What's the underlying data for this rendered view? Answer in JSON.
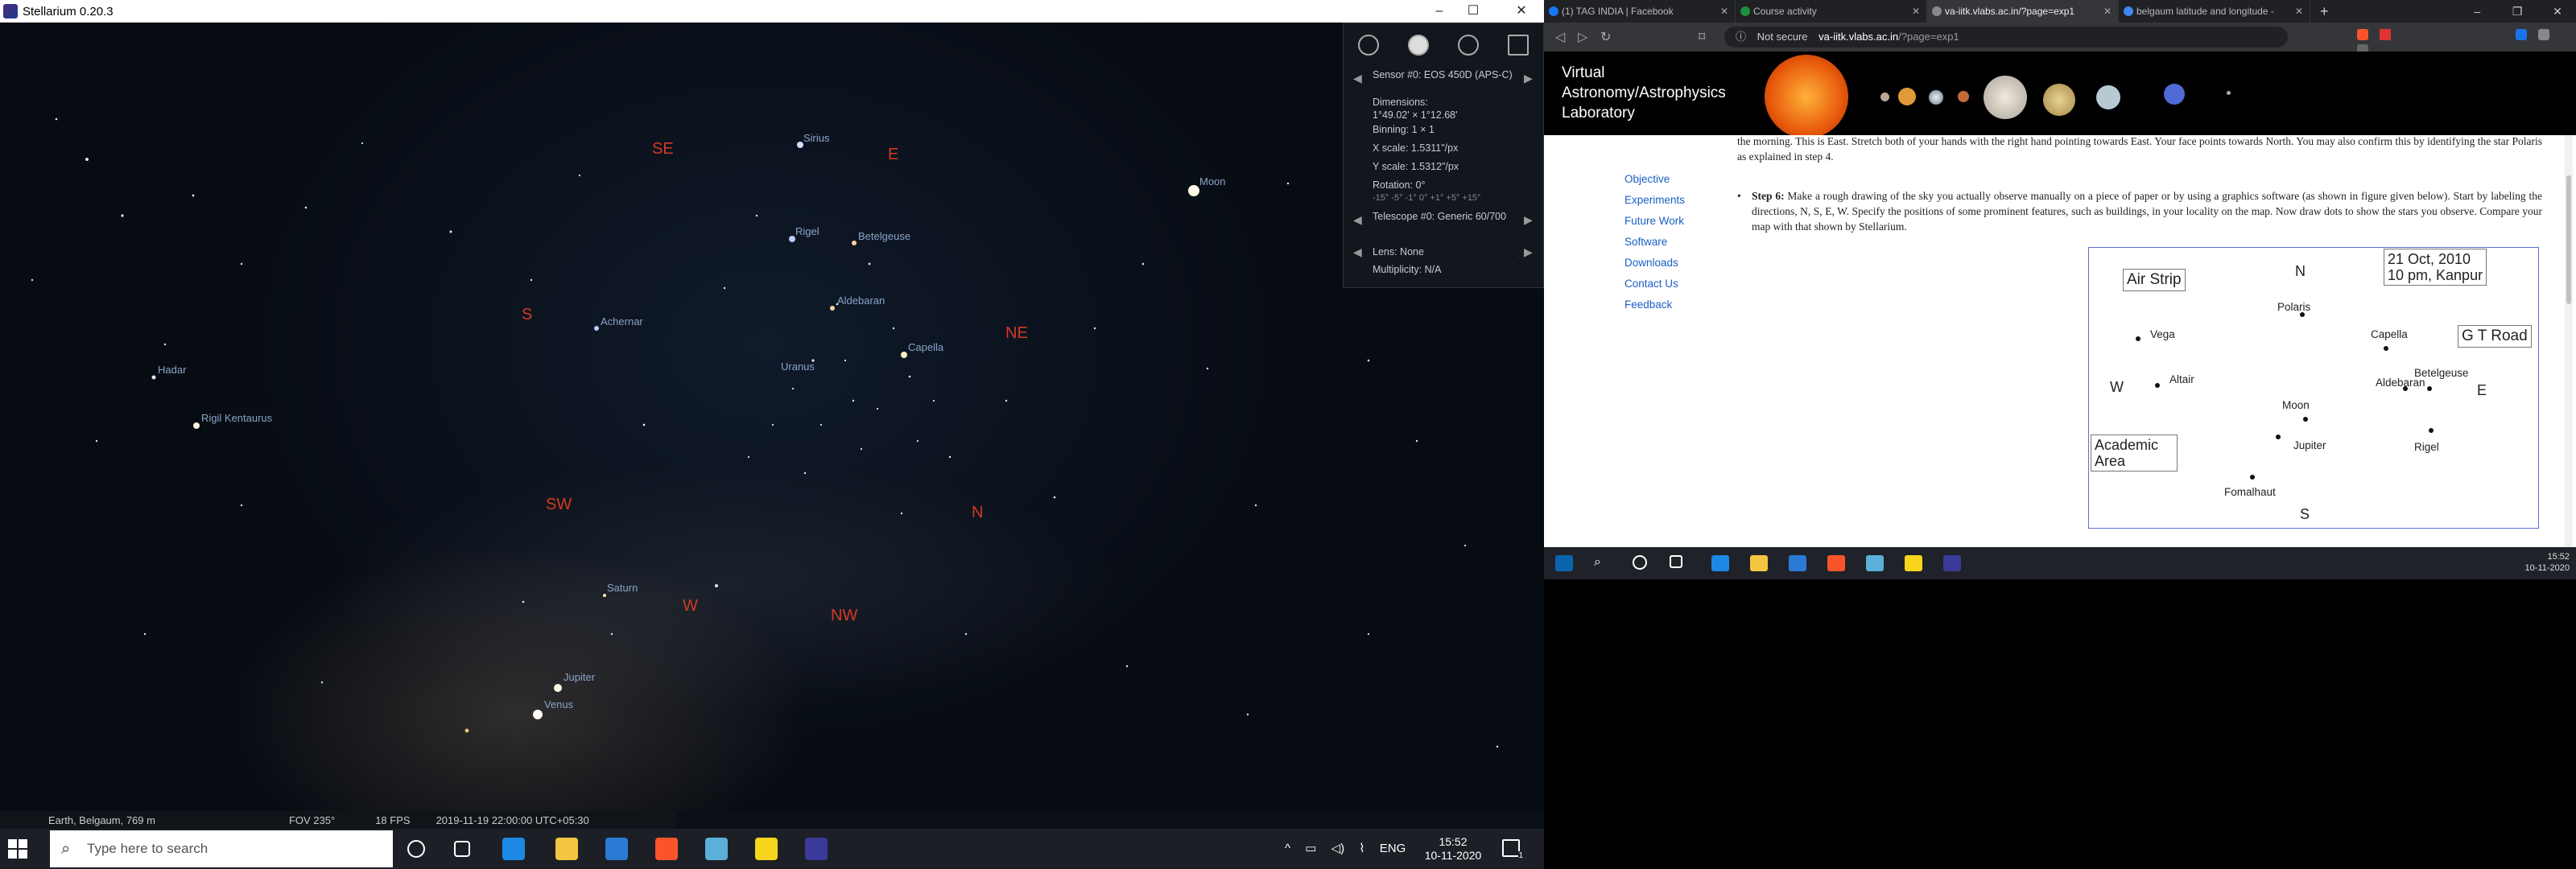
{
  "stellarium": {
    "title": "Stellarium 0.20.3",
    "window_controls": [
      "–",
      "☐",
      "✕"
    ],
    "stars": [
      {
        "name": "Sirius"
      },
      {
        "name": "Moon"
      },
      {
        "name": "Rigel"
      },
      {
        "name": "Betelgeuse"
      },
      {
        "name": "Aldebaran"
      },
      {
        "name": "Capella"
      },
      {
        "name": "Achernar"
      },
      {
        "name": "Uranus"
      },
      {
        "name": "Hadar"
      },
      {
        "name": "Rigil Kentaurus"
      },
      {
        "name": "Saturn"
      },
      {
        "name": "Jupiter"
      },
      {
        "name": "Venus"
      }
    ],
    "directions": [
      "SE",
      "E",
      "S",
      "NE",
      "SW",
      "N",
      "W",
      "NW"
    ],
    "sensor_panel": {
      "sensor": "Sensor #0: EOS 450D (APS-C)",
      "dimensions_label": "Dimensions:",
      "dimensions_value": "1°49.02' × 1°12.68'",
      "binning": "Binning: 1 × 1",
      "x_scale": "X scale: 1.5311\"/px",
      "y_scale": "Y scale: 1.5312\"/px",
      "rotation": "Rotation: 0°",
      "rotation_steps": "-15° -5° -1° 0° +1° +5° +15°",
      "telescope": "Telescope #0: Generic 60/700",
      "lens": "Lens: None",
      "multiplicity": "Multiplicity: N/A"
    },
    "status": {
      "location": "Earth, Belgaum, 769 m",
      "fov": "FOV 235°",
      "fps": "18 FPS",
      "datetime": "2019-11-19 22:00:00 UTC+05:30"
    }
  },
  "browser": {
    "tabs": [
      {
        "label": "(1) TAG INDIA | Facebook",
        "color": "#1877f2"
      },
      {
        "label": "Course activity",
        "color": "#1e8e3e"
      },
      {
        "label": "va-iitk.vlabs.ac.in/?page=exp1",
        "color": "#888888"
      },
      {
        "label": "belgaum latitude and longitude -",
        "color": "#4285f4"
      }
    ],
    "new_tab": "+",
    "window_controls": [
      "–",
      "❐",
      "✕"
    ],
    "url": {
      "security": "Not secure",
      "host": "va-iitk.vlabs.ac.in",
      "path": "/?page=exp1"
    },
    "site": {
      "title_lines": [
        "Virtual",
        "Astronomy/Astrophysics",
        "Laboratory"
      ],
      "nav": [
        "Objective",
        "Experiments",
        "Future Work",
        "Software",
        "Downloads",
        "Contact Us",
        "Feedback"
      ],
      "para1": "the morning. This is East. Stretch both of your hands with the right hand pointing towards East. Your face points towards North. You may also confirm this by identifying the star Polaris as explained in step 4.",
      "step_label": "Step 6:",
      "step_text": "Make a rough drawing of the sky you actually observe manually on a piece of paper or by using a graphics software (as shown in figure given below). Start by labeling the directions, N, S, E, W. Specify the positions of some prominent features, such as buildings, in your locality on the map. Now draw dots to show the stars you observe. Compare your map with that shown by Stellarium.",
      "figure": {
        "date_line1": "21 Oct, 2010",
        "date_line2": "10 pm, Kanpur",
        "air_strip": "Air Strip",
        "gt_road": "G T Road",
        "academic_line1": "Academic",
        "academic_line2": "Area",
        "dir_n": "N",
        "dir_s": "S",
        "dir_e": "E",
        "dir_w": "W",
        "stars": [
          {
            "name": "Polaris"
          },
          {
            "name": "Capella"
          },
          {
            "name": "Vega"
          },
          {
            "name": "Altair"
          },
          {
            "name": "Betelgeuse"
          },
          {
            "name": "Aldebaran"
          },
          {
            "name": "Moon"
          },
          {
            "name": "Jupiter"
          },
          {
            "name": "Rigel"
          },
          {
            "name": "Fomalhaut"
          }
        ]
      }
    }
  },
  "right_taskbar": {
    "time": "15:52",
    "date": "10-11-2020"
  },
  "taskbar": {
    "search_placeholder": "Type here to search",
    "tray_lang": "ENG",
    "tray_icons": [
      "^",
      "▭",
      "◁)",
      "⌇"
    ],
    "time": "15:52",
    "date": "10-11-2020",
    "notifications": "1"
  }
}
